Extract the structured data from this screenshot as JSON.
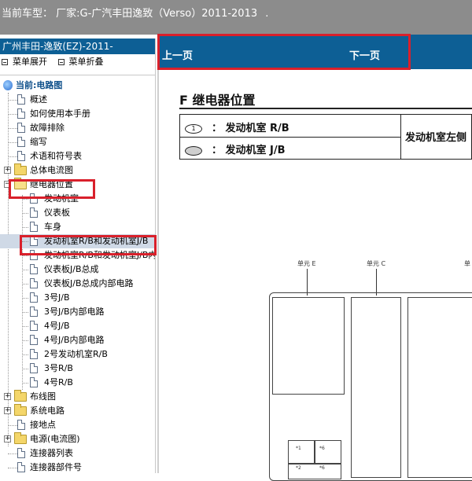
{
  "window": {
    "title_prefix": "当前车型：",
    "title_text": "厂家:G-广汽丰田逸致（Verso）2011-2013",
    "title_suffix": "."
  },
  "sidebar": {
    "header": "广州丰田-逸致(EZ)-2011-",
    "expand_all": "菜单展开",
    "collapse_all": "菜单折叠",
    "root_label": "当前:电路图",
    "items": [
      {
        "label": "概述",
        "icon": "doc"
      },
      {
        "label": "如何使用本手册",
        "icon": "doc"
      },
      {
        "label": "故障排除",
        "icon": "doc"
      },
      {
        "label": "缩写",
        "icon": "doc"
      },
      {
        "label": "术语和符号表",
        "icon": "doc"
      },
      {
        "label": "总体电流图",
        "icon": "folder"
      },
      {
        "label": "继电器位置",
        "icon": "folder-open"
      },
      {
        "label": "发动机室",
        "icon": "doc"
      },
      {
        "label": "仪表板",
        "icon": "doc"
      },
      {
        "label": "车身",
        "icon": "doc"
      },
      {
        "label": "发动机室R/B和发动机室J/B",
        "icon": "doc"
      },
      {
        "label": "发动机室R/B和发动机室J/B内",
        "icon": "doc"
      },
      {
        "label": "仪表板J/B总成",
        "icon": "doc"
      },
      {
        "label": "仪表板J/B总成内部电路",
        "icon": "doc"
      },
      {
        "label": "3号J/B",
        "icon": "doc"
      },
      {
        "label": "3号J/B内部电路",
        "icon": "doc"
      },
      {
        "label": "4号J/B",
        "icon": "doc"
      },
      {
        "label": "4号J/B内部电路",
        "icon": "doc"
      },
      {
        "label": "2号发动机室R/B",
        "icon": "doc"
      },
      {
        "label": "3号R/B",
        "icon": "doc"
      },
      {
        "label": "4号R/B",
        "icon": "doc"
      },
      {
        "label": "布线图",
        "icon": "folder"
      },
      {
        "label": "系统电路",
        "icon": "folder"
      },
      {
        "label": "接地点",
        "icon": "doc"
      },
      {
        "label": "电源(电流图)",
        "icon": "folder"
      },
      {
        "label": "连接器列表",
        "icon": "doc"
      },
      {
        "label": "连接器部件号",
        "icon": "doc"
      }
    ]
  },
  "nav": {
    "prev": "上一页",
    "next": "下一页"
  },
  "document": {
    "section_title": "F  继电器位置",
    "legend": [
      {
        "marker": "1",
        "label": "：  发动机室 R/B"
      },
      {
        "marker": "",
        "label": "：  发动机室 J/B"
      }
    ],
    "legend_right": "发动机室左侧",
    "units": [
      "单元 E",
      "单元 C",
      "单"
    ],
    "cell_labels": [
      "*1",
      "*6",
      "*2",
      "*6"
    ]
  },
  "colors": {
    "accent_blue": "#0d5f95",
    "title_gray": "#8c8c8c",
    "highlight_red": "#d9202b"
  }
}
